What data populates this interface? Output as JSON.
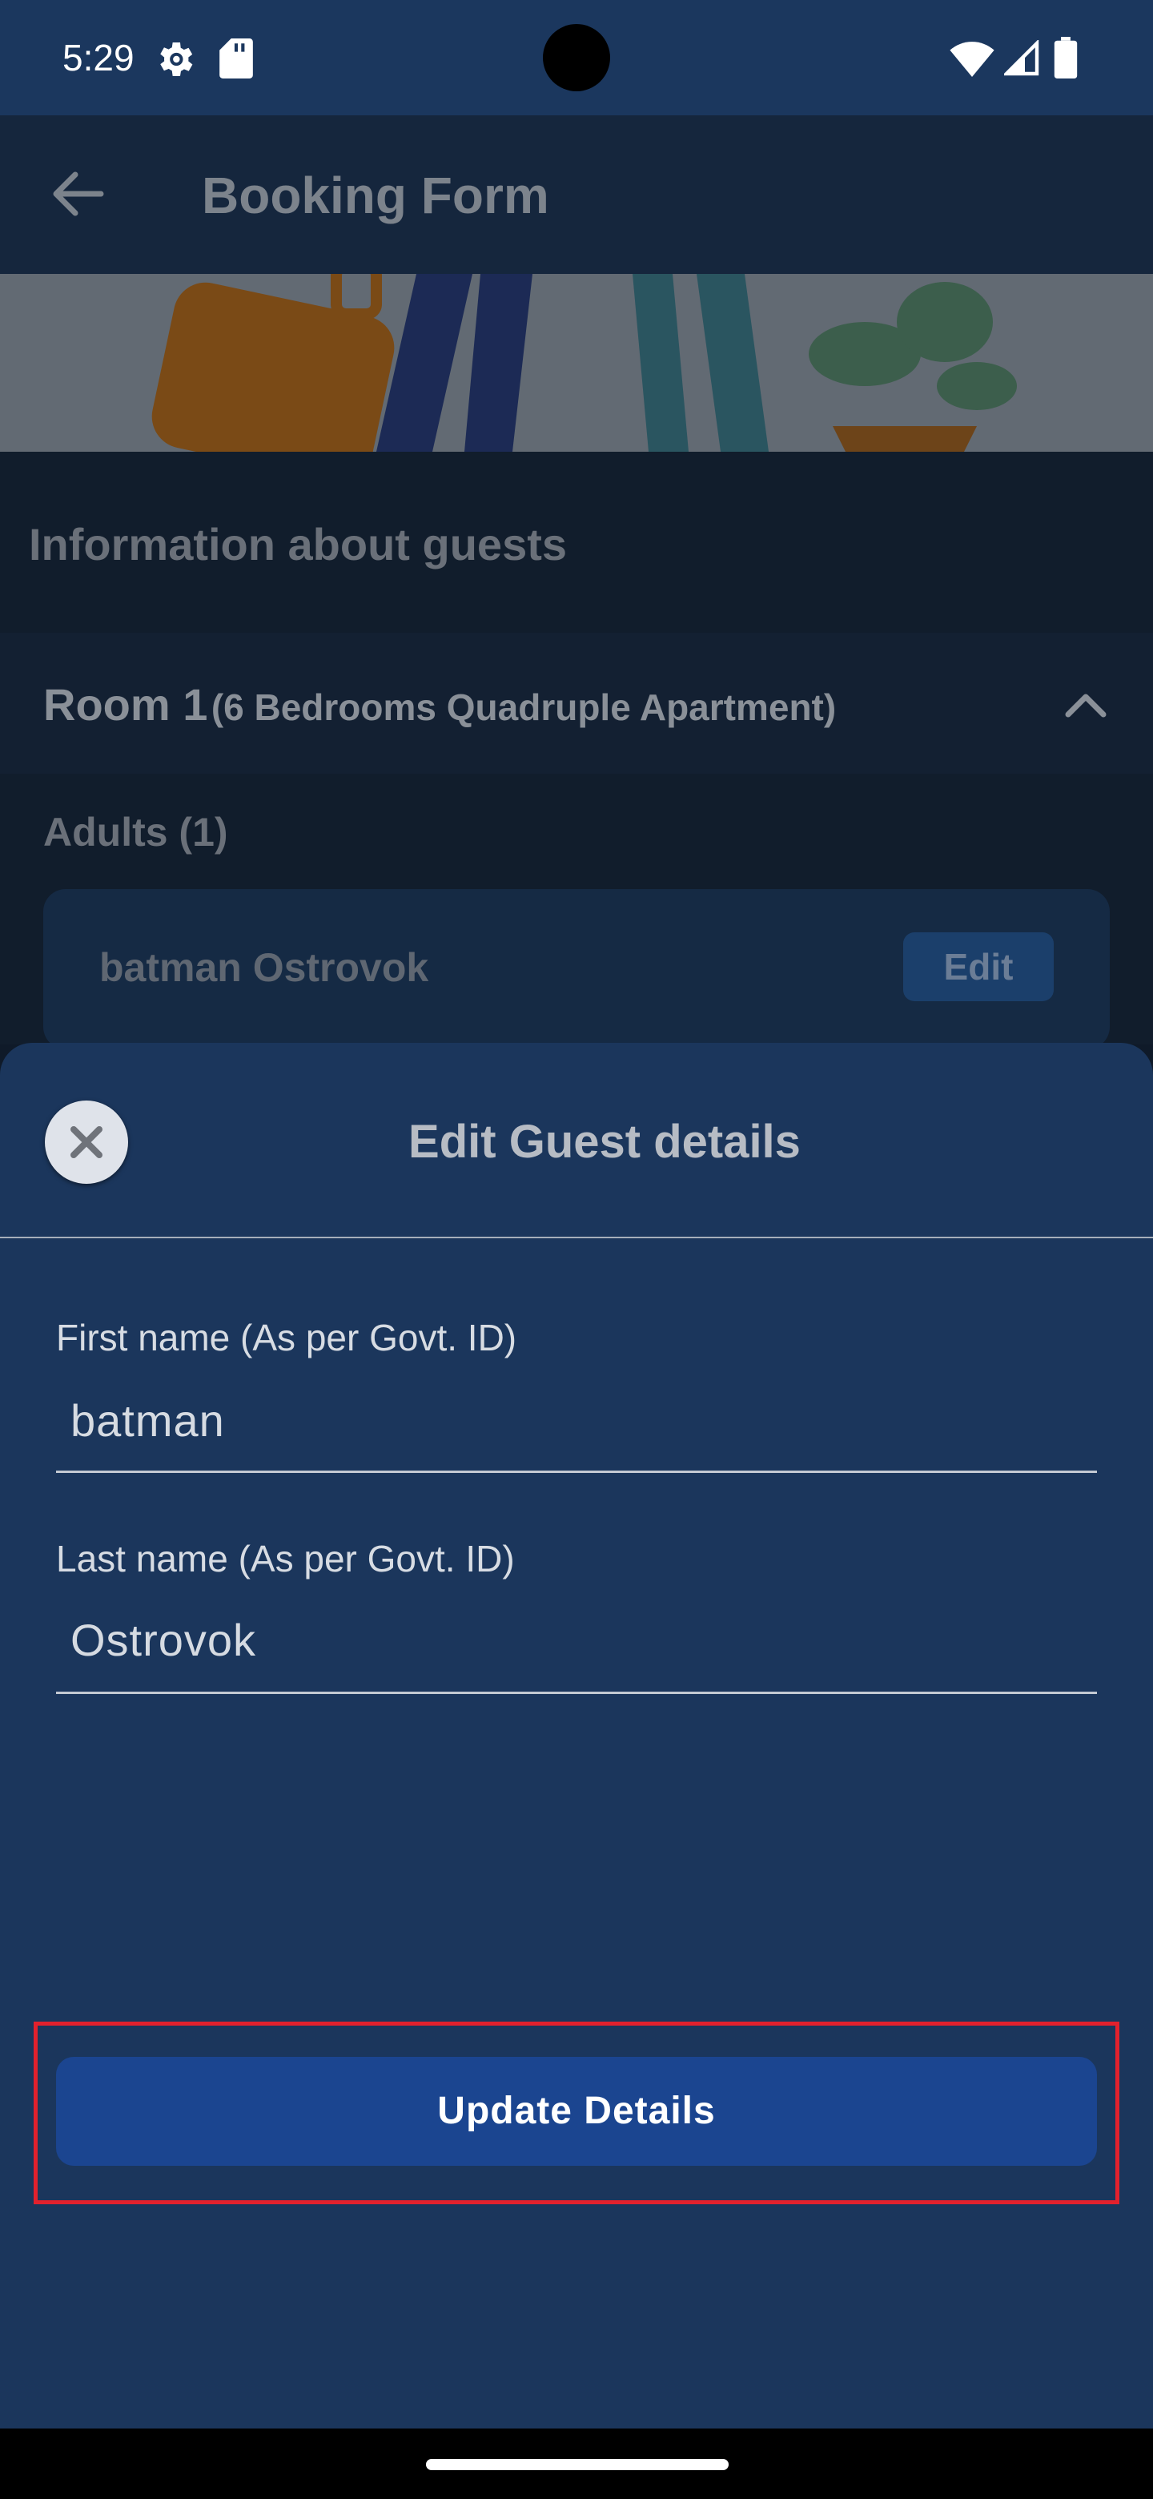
{
  "status_bar": {
    "time": "5:29",
    "icons": [
      "settings-icon",
      "sd-card-icon",
      "wifi-icon",
      "signal-icon",
      "battery-icon"
    ]
  },
  "app_bar": {
    "title": "Booking Form",
    "back_icon": "arrow-left-icon"
  },
  "content": {
    "guests_heading": "Information about guests",
    "room": {
      "number": "Room 1",
      "type": "(6 Bedrooms Quadruple Apartment)",
      "toggle_icon": "chevron-up-icon"
    },
    "adults_label": "Adults (1)",
    "guest": {
      "name": "batman Ostrovok",
      "edit_label": "Edit"
    }
  },
  "sheet": {
    "title": "Edit Guest details",
    "close_icon": "close-icon",
    "first_name": {
      "label": "First name (As per Govt. ID)",
      "value": "batman"
    },
    "last_name": {
      "label": "Last name (As per Govt. ID)",
      "value": "Ostrovok"
    },
    "submit_label": "Update Details"
  },
  "colors": {
    "sheet_bg": "#1b365c",
    "primary_button": "#1b4590",
    "highlight": "#e2212d",
    "status_bar": "#1b375e"
  }
}
